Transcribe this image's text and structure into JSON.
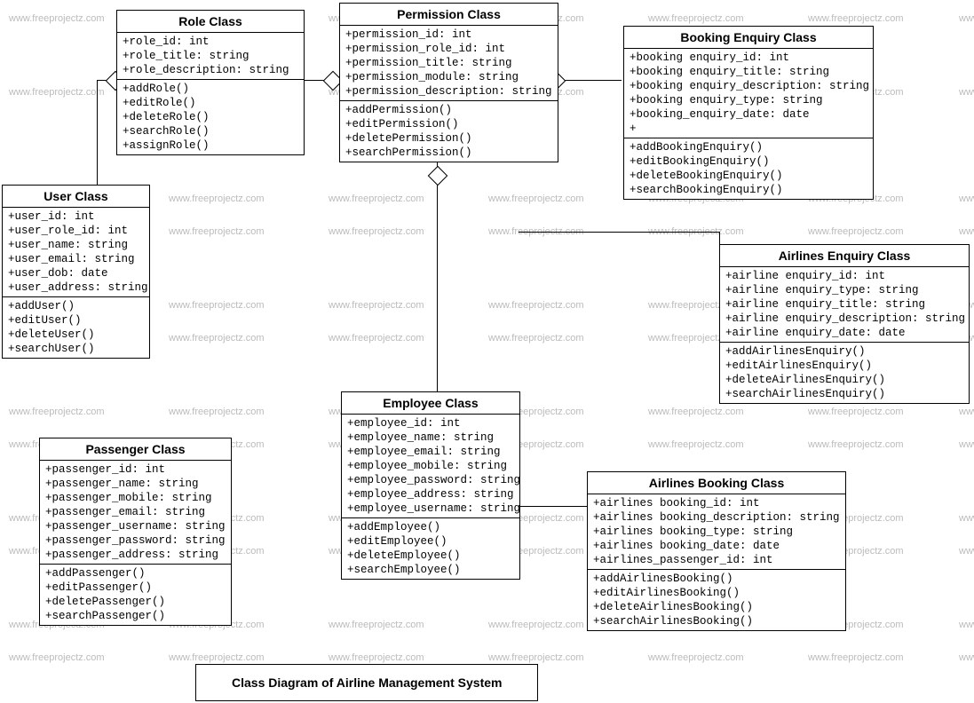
{
  "watermark_text": "www.freeprojectz.com",
  "title": "Class Diagram of Airline Management System",
  "classes": {
    "role": {
      "name": "Role Class",
      "attrs": [
        "+role_id: int",
        "+role_title: string",
        "+role_description: string"
      ],
      "ops": [
        "+addRole()",
        "+editRole()",
        "+deleteRole()",
        "+searchRole()",
        "+assignRole()"
      ]
    },
    "permission": {
      "name": "Permission Class",
      "attrs": [
        "+permission_id: int",
        "+permission_role_id: int",
        "+permission_title: string",
        "+permission_module: string",
        "+permission_description: string"
      ],
      "ops": [
        "+addPermission()",
        "+editPermission()",
        "+deletePermission()",
        "+searchPermission()"
      ]
    },
    "bookingEnquiry": {
      "name": "Booking Enquiry Class",
      "attrs": [
        "+booking enquiry_id: int",
        "+booking enquiry_title: string",
        "+booking enquiry_description: string",
        "+booking enquiry_type: string",
        "+booking_enquiry_date: date",
        "+"
      ],
      "ops": [
        "+addBookingEnquiry()",
        "+editBookingEnquiry()",
        "+deleteBookingEnquiry()",
        "+searchBookingEnquiry()"
      ]
    },
    "user": {
      "name": "User Class",
      "attrs": [
        "+user_id: int",
        "+user_role_id: int",
        "+user_name: string",
        "+user_email: string",
        "+user_dob: date",
        "+user_address: string"
      ],
      "ops": [
        "+addUser()",
        "+editUser()",
        "+deleteUser()",
        "+searchUser()"
      ]
    },
    "airlinesEnquiry": {
      "name": "Airlines Enquiry Class",
      "attrs": [
        "+airline enquiry_id: int",
        "+airline enquiry_type: string",
        "+airline enquiry_title: string",
        "+airline enquiry_description: string",
        "+airline enquiry_date: date"
      ],
      "ops": [
        "+addAirlinesEnquiry()",
        "+editAirlinesEnquiry()",
        "+deleteAirlinesEnquiry()",
        "+searchAirlinesEnquiry()"
      ]
    },
    "employee": {
      "name": "Employee Class",
      "attrs": [
        "+employee_id: int",
        "+employee_name: string",
        "+employee_email: string",
        "+employee_mobile: string",
        "+employee_password: string",
        "+employee_address: string",
        "+employee_username: string"
      ],
      "ops": [
        "+addEmployee()",
        "+editEmployee()",
        "+deleteEmployee()",
        "+searchEmployee()"
      ]
    },
    "passenger": {
      "name": "Passenger Class",
      "attrs": [
        "+passenger_id: int",
        "+passenger_name: string",
        "+passenger_mobile: string",
        "+passenger_email: string",
        "+passenger_username: string",
        "+passenger_password: string",
        "+passenger_address: string"
      ],
      "ops": [
        "+addPassenger()",
        "+editPassenger()",
        "+deletePassenger()",
        "+searchPassenger()"
      ]
    },
    "airlinesBooking": {
      "name": "Airlines Booking Class",
      "attrs": [
        "+airlines booking_id: int",
        "+airlines booking_description: string",
        "+airlines booking_type: string",
        "+airlines booking_date: date",
        "+airlines_passenger_id: int"
      ],
      "ops": [
        "+addAirlinesBooking()",
        "+editAirlinesBooking()",
        "+deleteAirlinesBooking()",
        "+searchAirlinesBooking()"
      ]
    }
  }
}
